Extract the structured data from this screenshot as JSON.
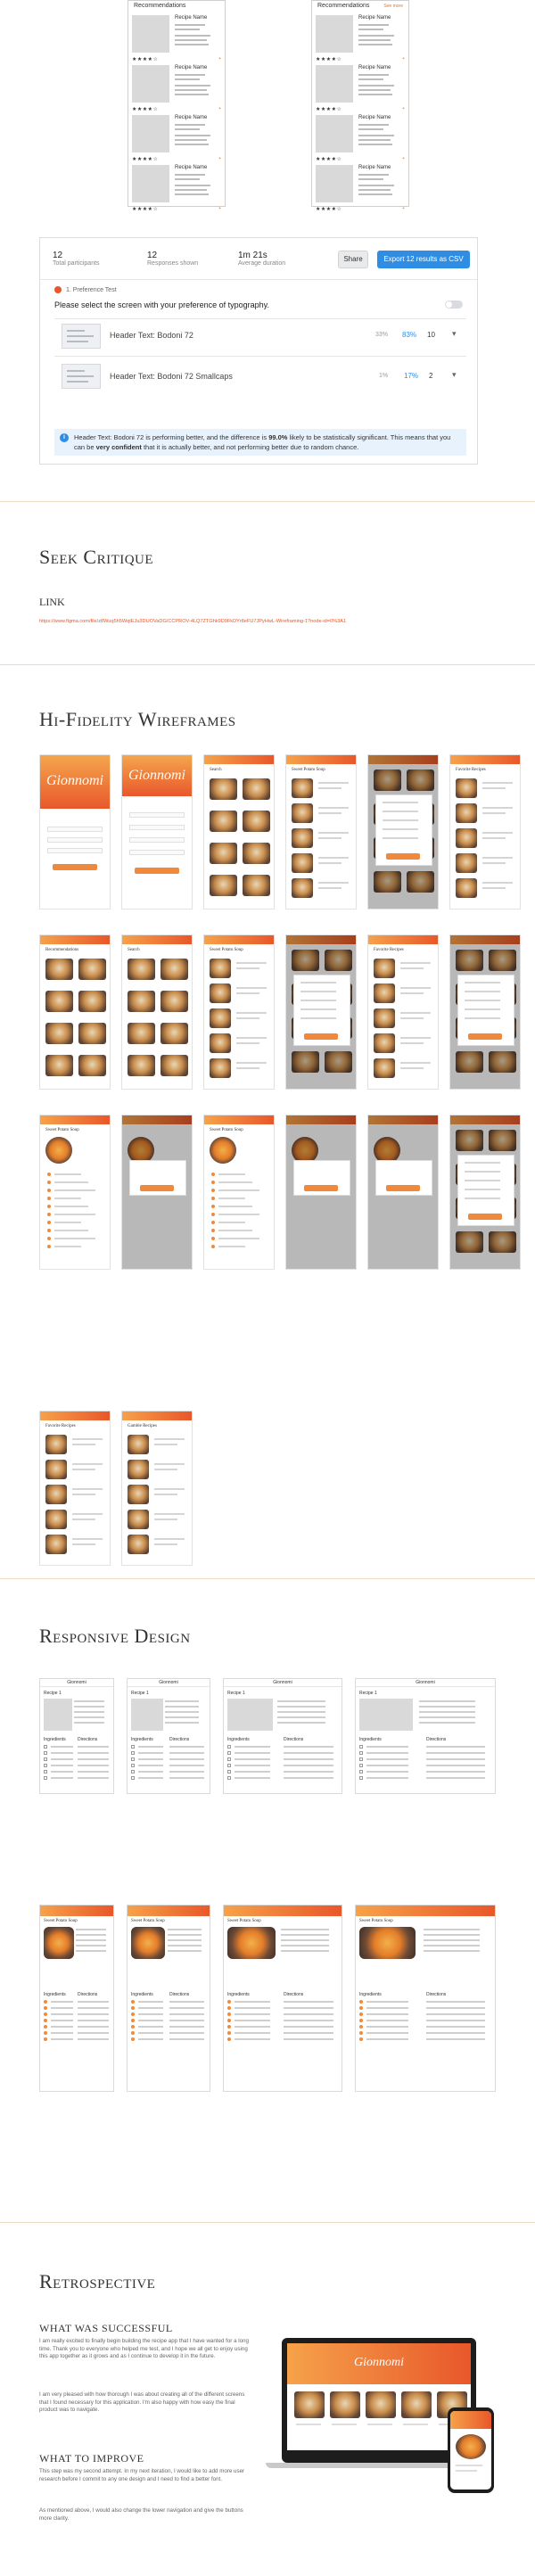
{
  "top_wireframes": {
    "left_header": "Recommendations",
    "right_header": "Recommendations",
    "right_action": "See more",
    "recipe_name": "Recipe Name",
    "stars": "★★★★☆",
    "add_label": "+"
  },
  "test_result": {
    "stats": [
      {
        "value": "12",
        "label": "Total participants"
      },
      {
        "value": "12",
        "label": "Responses shown"
      },
      {
        "value": "1m 21s",
        "label": "Average duration"
      }
    ],
    "share_label": "Share",
    "export_label": "Export 12 results as CSV",
    "question_tag": "1. Preference Test",
    "question": "Please select the screen with your preference of typography.",
    "options": [
      {
        "label": "Header Text: Bodoni 72",
        "pct_small": "33%",
        "pct": "83%",
        "count": "10"
      },
      {
        "label": "Header Text: Bodoni 72 Smallcaps",
        "pct_small": "1%",
        "pct": "17%",
        "count": "2"
      }
    ],
    "notice_prefix": "Header Text: Bodoni 72 is performing better, and the difference is ",
    "notice_bold": "99.0%",
    "notice_mid": " likely to be statistically significant. This means that you can be ",
    "notice_bold2": "very confident",
    "notice_suffix": " that it is actually better, and not performing better due to random chance."
  },
  "critique": {
    "title": "Seek Critique",
    "link_label": "LINK",
    "link_url": "https://www.figma.com/file/z8Wuq5h5WqtEJu3DUOVaDG/CCPROV-4LQ7ZTGhk9D9FkDYr8eFU7JPyHwL-Wireframing-1?node-id=0%3A1"
  },
  "hifi": {
    "title": "Hi-Fidelity Wireframes",
    "brand": "Gionnomi",
    "screen_titles": [
      "Recommendations",
      "Recommendations",
      "Search",
      "Sweet Potato Soup",
      "Sweet Potato Soup",
      "Favorite Recipes",
      "Gamble Recipes"
    ]
  },
  "responsive": {
    "title": "Responsive Design",
    "header_label": "Gionnomi",
    "recipe_label": "Recipe 1",
    "soup_title": "Sweet Potato Soup",
    "ingredients_label": "Ingredients",
    "directions_label": "Directions"
  },
  "retrospective": {
    "title": "Retrospective",
    "success_heading": "WHAT WAS SUCCESSFUL",
    "success_p1": "I am really excited to finally begin building the recipe app that I have wanted for a long time. Thank you to everyone who helped me test, and I hope we all get to enjoy using this app together as it grows and as I continue to develop it in the future.",
    "success_p2": "I am very pleased with how thorough I was about creating all of the different screens that I found necessary for this application. I'm also happy with how easy the final product was to navigate.",
    "improve_heading": "WHAT TO IMPROVE",
    "improve_p1": "This step was my second attempt. In my next iteration, I would like to add more user research before I commit to any one design and I need to find a better font.",
    "improve_p2": "As mentioned above, I would also change the lower navigation and give the buttons more clarity."
  },
  "colors": {
    "accent": "#e8572a",
    "accent_light": "#f6a24a",
    "link": "#e8572a",
    "button_blue": "#2f8de4"
  }
}
